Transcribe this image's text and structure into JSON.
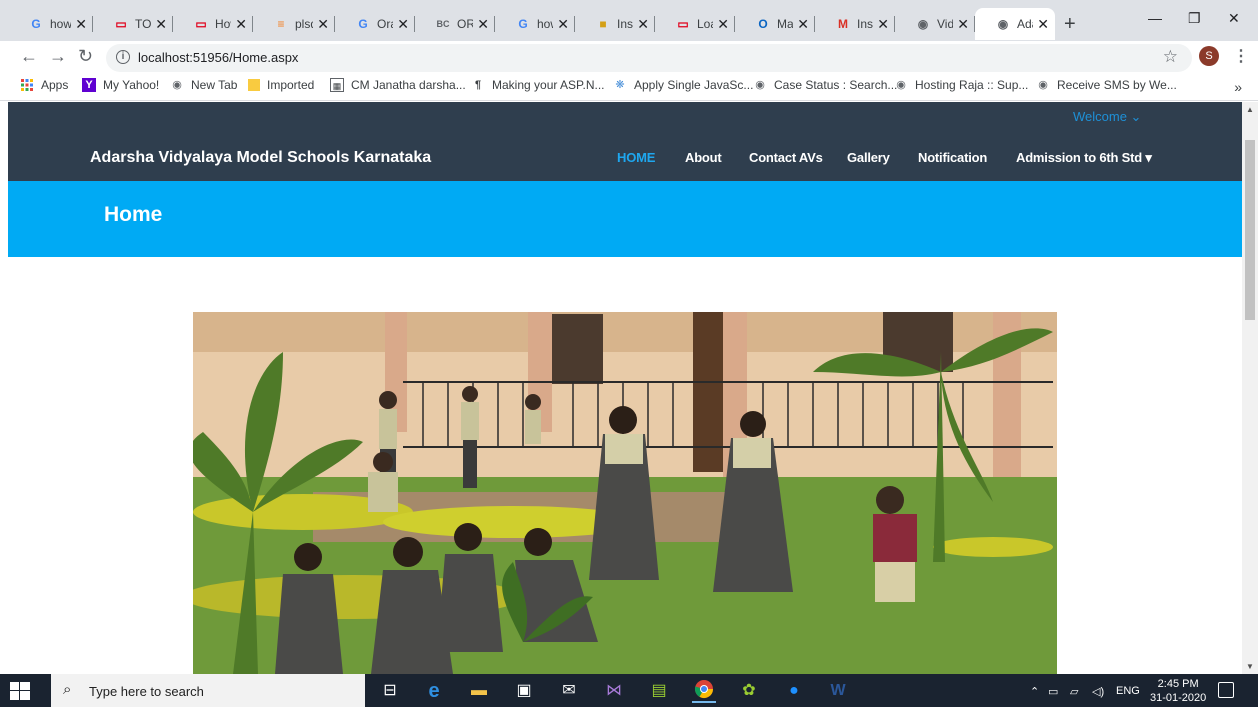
{
  "browser": {
    "tabs": [
      {
        "label": "how",
        "icon": "google-icon"
      },
      {
        "label": "TO_l",
        "icon": "oracle-icon"
      },
      {
        "label": "How",
        "icon": "oracle-icon"
      },
      {
        "label": "plsq",
        "icon": "stackoverflow-icon"
      },
      {
        "label": "Orac",
        "icon": "google-icon"
      },
      {
        "label": "ORA",
        "icon": "bc-icon"
      },
      {
        "label": "how",
        "icon": "google-icon"
      },
      {
        "label": "Inse",
        "icon": "page-icon"
      },
      {
        "label": "Loa",
        "icon": "oracle-icon"
      },
      {
        "label": "Mail",
        "icon": "outlook-icon"
      },
      {
        "label": "Insti",
        "icon": "gmail-icon"
      },
      {
        "label": "Vidy",
        "icon": "globe-icon"
      },
      {
        "label": "Ada",
        "icon": "globe-icon"
      }
    ],
    "new_tab": "+",
    "window": {
      "minimize": "—",
      "restore": "❐",
      "close": "✕"
    },
    "url": "localhost:51956/Home.aspx",
    "profile_initial": "S",
    "bookmarks": [
      {
        "label": "Apps",
        "icon": "apps-grid-icon"
      },
      {
        "label": "My Yahoo!",
        "icon": "yahoo-icon"
      },
      {
        "label": "New Tab",
        "icon": "globe-icon"
      },
      {
        "label": "Imported",
        "icon": "folder-icon"
      },
      {
        "label": "CM Janatha darsha...",
        "icon": "page-icon"
      },
      {
        "label": "Making your ASP.N...",
        "icon": "pilcrow-icon"
      },
      {
        "label": "Apply Single JavaSc...",
        "icon": "page-icon"
      },
      {
        "label": "Case Status : Search...",
        "icon": "globe-icon"
      },
      {
        "label": "Hosting Raja :: Sup...",
        "icon": "globe-icon"
      },
      {
        "label": "Receive SMS by We...",
        "icon": "globe-icon"
      }
    ],
    "bookmarks_more": "»"
  },
  "site": {
    "welcome": "Welcome ⌄",
    "brand": "Adarsha Vidyalaya Model Schools Karnataka",
    "nav": [
      {
        "label": "HOME",
        "active": true
      },
      {
        "label": "About"
      },
      {
        "label": "Contact AVs"
      },
      {
        "label": "Gallery"
      },
      {
        "label": "Notification"
      },
      {
        "label": "Admission to 6th Std ▾"
      }
    ],
    "page_title": "Home",
    "colors": {
      "navbar": "#2f3e4e",
      "banner": "#00aaf4",
      "active_link": "#1ea7ef"
    }
  },
  "taskbar": {
    "search_placeholder": "Type here to search",
    "tray_lang": "ENG",
    "time": "2:45 PM",
    "date": "31-01-2020"
  }
}
